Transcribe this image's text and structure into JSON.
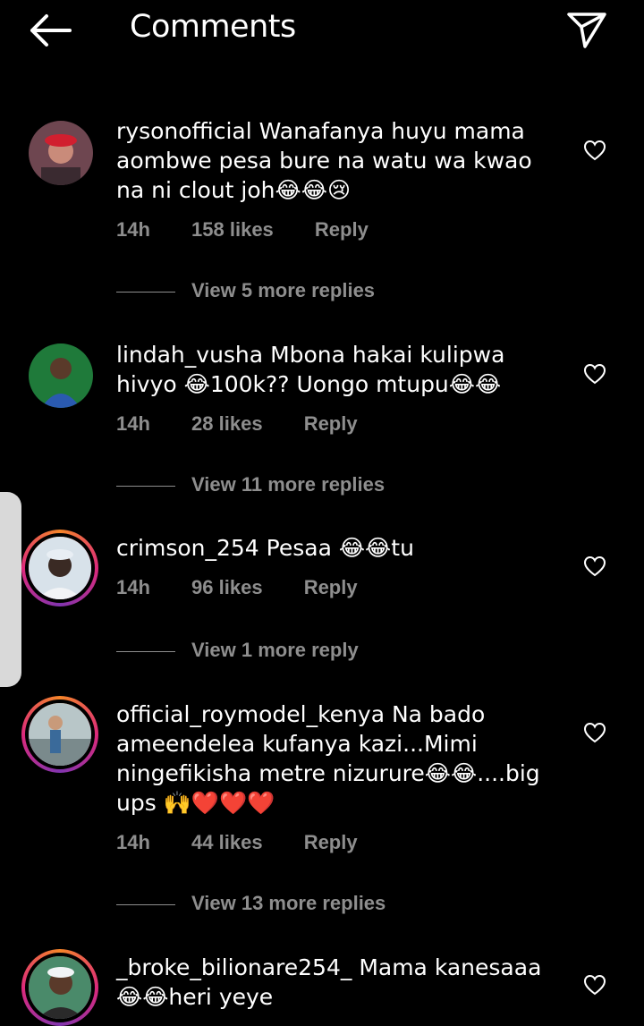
{
  "header": {
    "title": "Comments"
  },
  "comments": [
    {
      "username": "rysonofficial",
      "text": "Wanafanya huyu mama aombwe pesa bure na watu wa kwao na ni clout joh😂😂😢",
      "time": "14h",
      "likes": "158 likes",
      "reply": "Reply",
      "view_replies": "View 5 more replies",
      "avatar_color": "#7a4a52"
    },
    {
      "username": "lindah_vusha",
      "text": "Mbona hakai kulipwa hivyo 😂100k?? Uongo mtupu😂😂",
      "time": "14h",
      "likes": "28 likes",
      "reply": "Reply",
      "view_replies": "View 11 more replies",
      "avatar_color": "#2a8a4a"
    },
    {
      "username": "crimson_254",
      "text": "Pesaa 😂😂tu",
      "time": "14h",
      "likes": "96 likes",
      "reply": "Reply",
      "view_replies": "View 1 more reply",
      "avatar_color": "#c9d6e0"
    },
    {
      "username": "official_roymodel_kenya",
      "text": "Na bado ameendelea kufanya kazi...Mimi ningefikisha metre nizurure😂😂....big ups 🙌❤️❤️❤️",
      "time": "14h",
      "likes": "44 likes",
      "reply": "Reply",
      "view_replies": "View 13 more replies",
      "avatar_color": "#8aa0b0"
    },
    {
      "username": "_broke_bilionare254_",
      "text": "Mama kanesaaa 😂😂heri yeye",
      "avatar_color": "#3a7a5a"
    }
  ]
}
